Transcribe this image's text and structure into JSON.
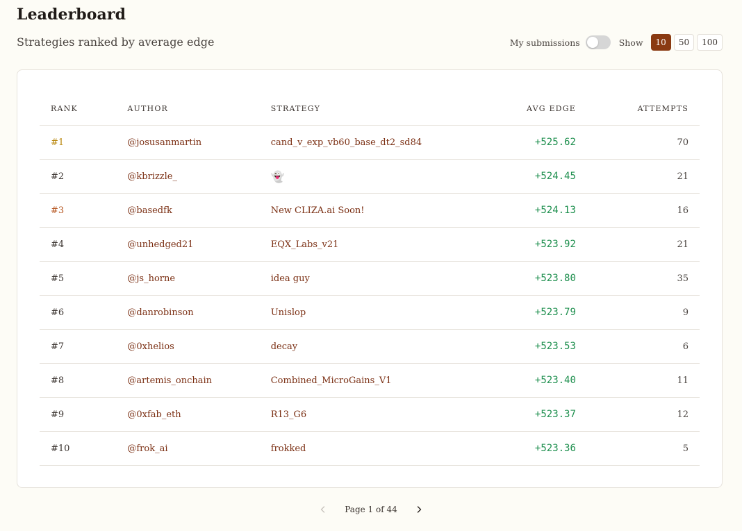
{
  "header": {
    "title": "Leaderboard",
    "subtitle": "Strategies ranked by average edge"
  },
  "controls": {
    "my_submissions_label": "My submissions",
    "my_submissions_on": false,
    "show_label": "Show",
    "page_sizes": [
      "10",
      "50",
      "100"
    ],
    "selected_page_size": "10"
  },
  "table": {
    "columns": [
      "Rank",
      "Author",
      "Strategy",
      "Avg Edge",
      "Attempts"
    ],
    "rows": [
      {
        "rank": "#1",
        "author": "@josusanmartin",
        "strategy": "cand_v_exp_vb60_base_dt2_sd84",
        "avg_edge": "+525.62",
        "attempts": "70"
      },
      {
        "rank": "#2",
        "author": "@kbrizzle_",
        "strategy": "👻",
        "avg_edge": "+524.45",
        "attempts": "21"
      },
      {
        "rank": "#3",
        "author": "@basedfk",
        "strategy": "New CLIZA.ai Soon!",
        "avg_edge": "+524.13",
        "attempts": "16"
      },
      {
        "rank": "#4",
        "author": "@unhedged21",
        "strategy": "EQX_Labs_v21",
        "avg_edge": "+523.92",
        "attempts": "21"
      },
      {
        "rank": "#5",
        "author": "@js_horne",
        "strategy": "idea guy",
        "avg_edge": "+523.80",
        "attempts": "35"
      },
      {
        "rank": "#6",
        "author": "@danrobinson",
        "strategy": "Unislop",
        "avg_edge": "+523.79",
        "attempts": "9"
      },
      {
        "rank": "#7",
        "author": "@0xhelios",
        "strategy": "decay",
        "avg_edge": "+523.53",
        "attempts": "6"
      },
      {
        "rank": "#8",
        "author": "@artemis_onchain",
        "strategy": "Combined_MicroGains_V1",
        "avg_edge": "+523.40",
        "attempts": "11"
      },
      {
        "rank": "#9",
        "author": "@0xfab_eth",
        "strategy": "R13_G6",
        "avg_edge": "+523.37",
        "attempts": "12"
      },
      {
        "rank": "#10",
        "author": "@frok_ai",
        "strategy": "frokked",
        "avg_edge": "+523.36",
        "attempts": "5"
      }
    ]
  },
  "pagination": {
    "page_text": "Page 1 of 44",
    "prev_icon": "chevron-left-icon",
    "next_icon": "chevron-right-icon"
  },
  "colors": {
    "accent": "#8a3a12",
    "positive": "#1e8f4e",
    "rank_gold": "#b8860b",
    "rank_bronze": "#b5541e",
    "link": "#7a2e12"
  }
}
